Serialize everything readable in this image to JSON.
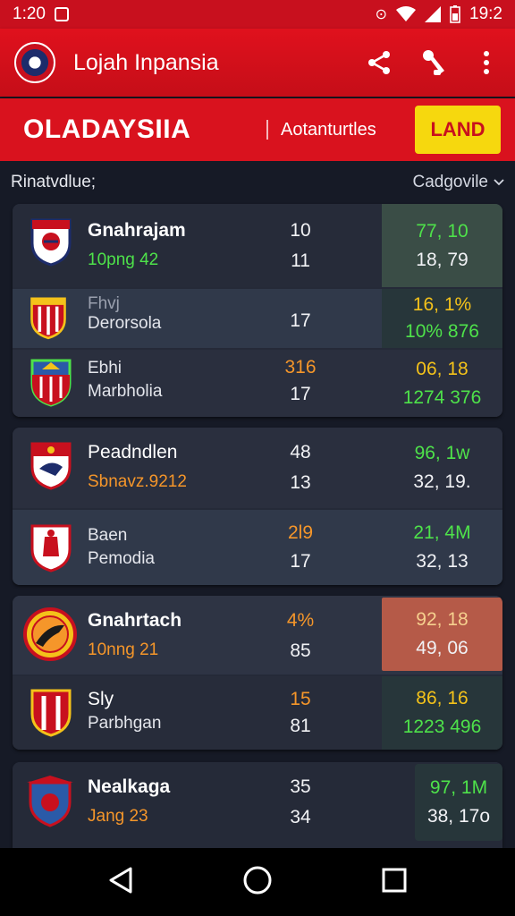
{
  "status_bar": {
    "time": "1:20",
    "clock_right": "19:2"
  },
  "app_bar": {
    "title": "Lojah Inpansia"
  },
  "sub_bar": {
    "title": "OLADAYSIIA",
    "link": "Aotanturtles",
    "badge": "LAND"
  },
  "filter": {
    "left_label": "Rinatvdlue;",
    "right_label": "Cadgovile"
  },
  "colors": {
    "brand_red": "#d9121e",
    "badge_yellow": "#f6d80e",
    "up_green": "#4ee24a",
    "accent_orange": "#f5962a"
  },
  "groups": [
    {
      "rows": [
        {
          "name": "Gnahrajam",
          "sub": "10png 42",
          "num1": "10",
          "num2": "11",
          "score1": "77, 10",
          "score2": "18, 79"
        },
        {
          "name_small": "Fhvj",
          "name": "Derorsola",
          "num2": "17",
          "score1": "16, 1%",
          "score2": "10% 876"
        },
        {
          "name_small": "Ebhi",
          "name": "Marbholia",
          "num1": "316",
          "num2": "17",
          "score1": "06, 18",
          "score2": "1274 376"
        }
      ]
    },
    {
      "rows": [
        {
          "name": "Peadndlen",
          "sub": "Sbnavz.9212",
          "num1": "48",
          "num2": "13",
          "score1": "96, 1w",
          "score2": "32, 19."
        },
        {
          "name_small": "Baen",
          "name": "Pemodia",
          "num1": "2l9",
          "num2": "17",
          "score1": "21, 4M",
          "score2": "32, 13"
        }
      ]
    },
    {
      "rows": [
        {
          "name": "Gnahrtach",
          "sub": "10nng 21",
          "num1": "4%",
          "num2": "85",
          "score1": "92, 18",
          "score2": "49, 06"
        },
        {
          "name_small": "Sly",
          "name": "Parbhgan",
          "num1": "15",
          "num2": "81",
          "score1": "86, 16",
          "score2": "1223 496"
        }
      ]
    },
    {
      "rows": [
        {
          "name": "Nealkaga",
          "sub": "Jang 23",
          "num1": "35",
          "num2": "34",
          "score1": "97, 1M",
          "score2": "38, 17o"
        }
      ]
    }
  ]
}
